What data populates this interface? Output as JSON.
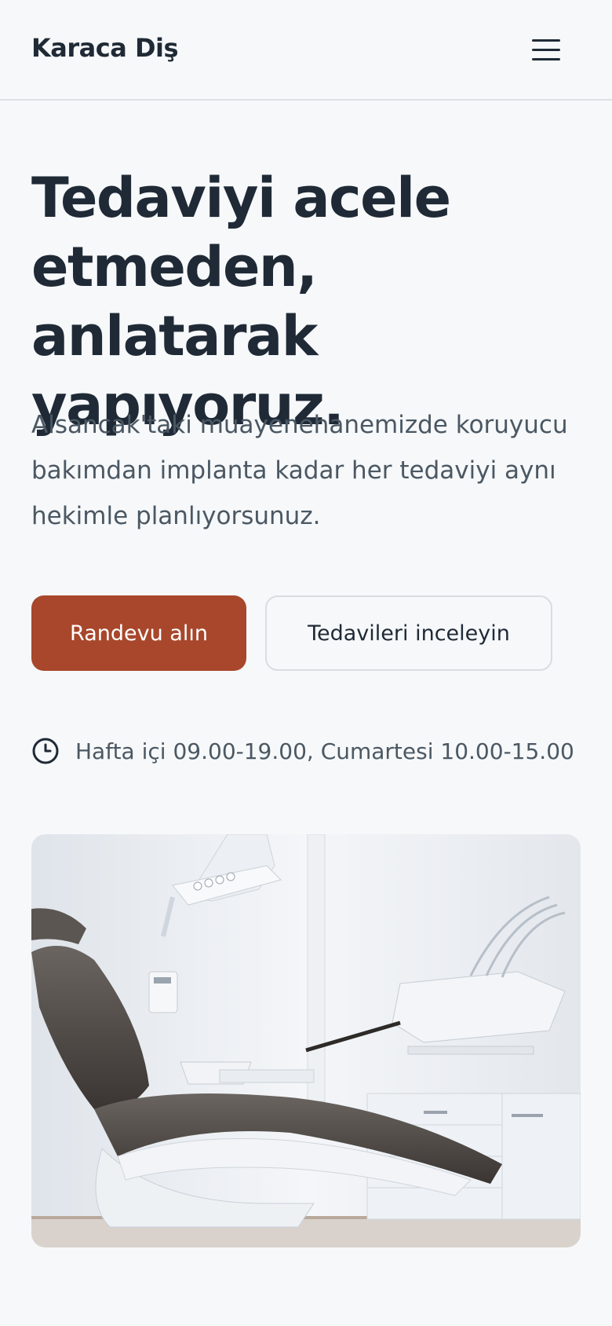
{
  "header": {
    "brand": "Karaca Diş",
    "menu_icon": "hamburger-menu-icon"
  },
  "hero": {
    "title": "Tedaviyi acele etmeden, anlatarak yapıyoruz.",
    "description": "Alsancak'taki muayenehanemizde koruyucu bakımdan implanta kadar her tedaviyi aynı hekimle planlıyorsunuz.",
    "primary_cta": "Randevu alın",
    "secondary_cta": "Tedavileri inceleyin",
    "hours_icon": "clock-icon",
    "hours": "Hafta içi 09.00-19.00, Cumartesi 10.00-15.00"
  },
  "colors": {
    "accent": "#a8472b",
    "text": "#1f2a36",
    "muted": "#4b5863",
    "background": "#f6f8fa"
  }
}
